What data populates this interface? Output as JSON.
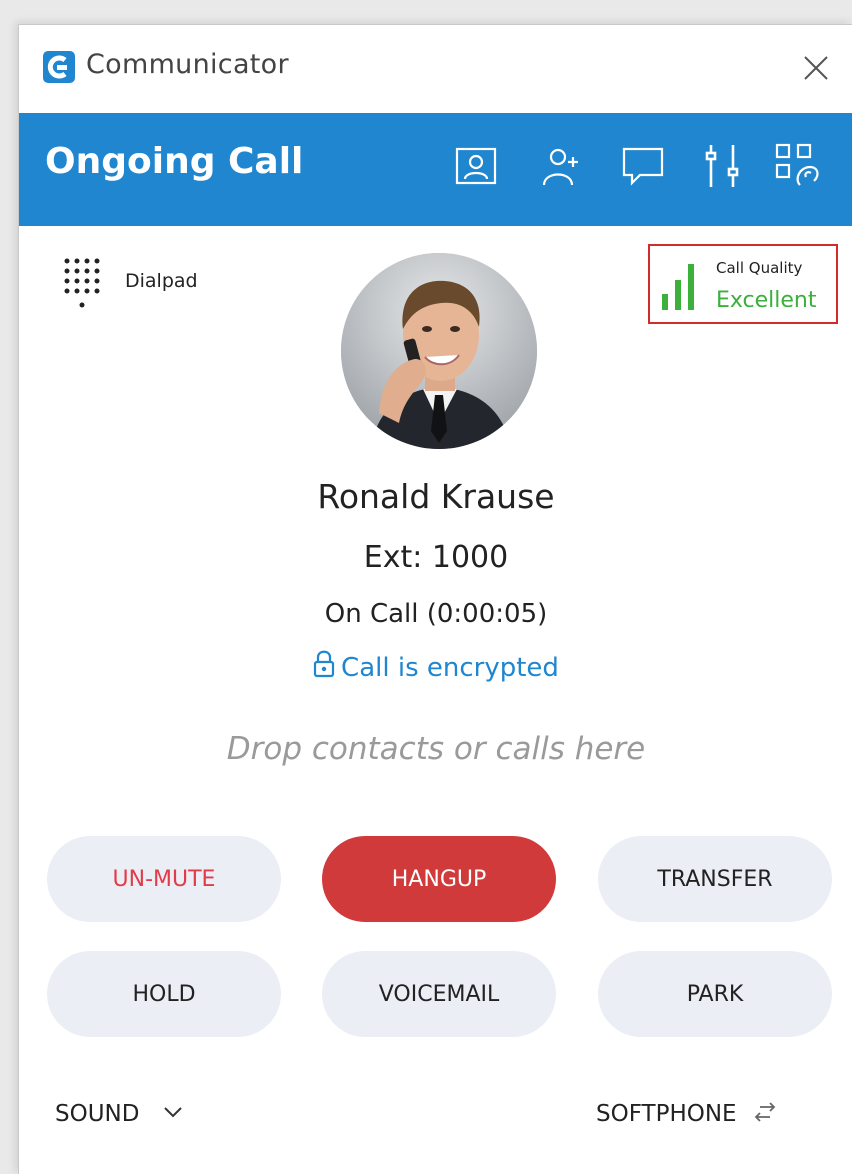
{
  "app": {
    "title": "Communicator",
    "brand_color": "#1f86cf"
  },
  "header": {
    "title": "Ongoing Call",
    "icons": [
      "contact-card-icon",
      "add-contact-icon",
      "chat-icon",
      "settings-sliders-icon",
      "qr-scan-icon"
    ]
  },
  "dialpad": {
    "label": "Dialpad"
  },
  "call_quality": {
    "label": "Call Quality",
    "value": "Excellent",
    "color": "#3bb03b"
  },
  "contact": {
    "name": "Ronald Krause",
    "extension": "Ext: 1000",
    "status": "On Call (0:00:05)",
    "encryption": "Call is encrypted"
  },
  "drop_zone": {
    "text": "Drop contacts or calls here"
  },
  "actions": {
    "unmute": "UN-MUTE",
    "hangup": "HANGUP",
    "transfer": "TRANSFER",
    "hold": "HOLD",
    "voicemail": "VOICEMAIL",
    "park": "PARK"
  },
  "footer": {
    "sound": "SOUND",
    "softphone": "SOFTPHONE"
  },
  "colors": {
    "hangup": "#d13a3a",
    "mute_text": "#e23b4a",
    "button_bg": "#eceef5"
  }
}
